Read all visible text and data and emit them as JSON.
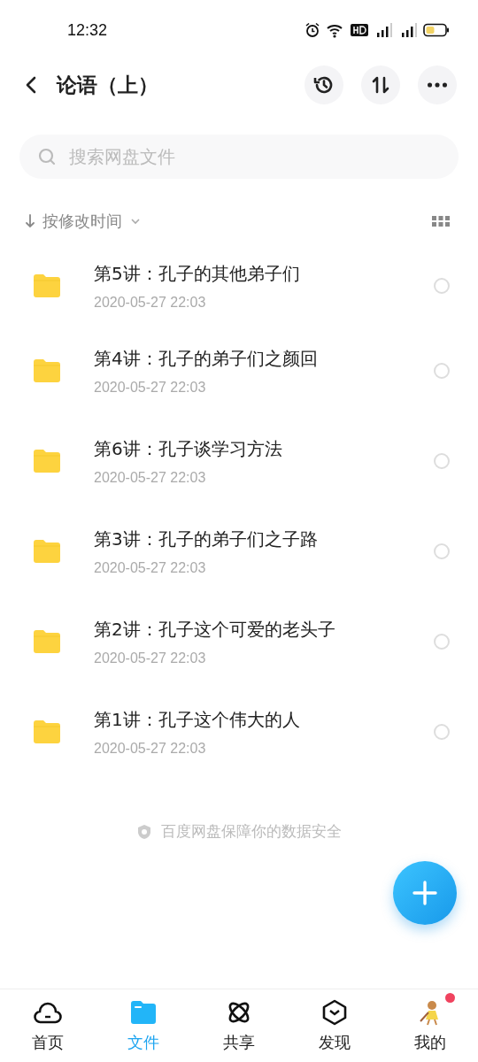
{
  "status_bar": {
    "time": "12:32"
  },
  "header": {
    "title": "论语（上）"
  },
  "search": {
    "placeholder": "搜索网盘文件"
  },
  "sort": {
    "label": "按修改时间"
  },
  "files": [
    {
      "name": "第5讲：孔子的其他弟子们",
      "date": "2020-05-27  22:03",
      "selected": false
    },
    {
      "name": "第4讲：孔子的弟子们之颜回",
      "date": "2020-05-27  22:03",
      "selected": false
    },
    {
      "name": "第6讲：孔子谈学习方法",
      "date": "2020-05-27  22:03",
      "selected": false
    },
    {
      "name": "第3讲：孔子的弟子们之子路",
      "date": "2020-05-27  22:03",
      "selected": false
    },
    {
      "name": "第2讲：孔子这个可爱的老头子",
      "date": "2020-05-27  22:03",
      "selected": false
    },
    {
      "name": "第1讲：孔子这个伟大的人",
      "date": "2020-05-27  22:03",
      "selected": false
    }
  ],
  "footer_note": "百度网盘保障你的数据安全",
  "tabs": [
    {
      "label": "首页",
      "selected": false,
      "dot": false
    },
    {
      "label": "文件",
      "selected": true,
      "dot": false
    },
    {
      "label": "共享",
      "selected": false,
      "dot": false
    },
    {
      "label": "发现",
      "selected": false,
      "dot": false
    },
    {
      "label": "我的",
      "selected": false,
      "dot": true
    }
  ]
}
